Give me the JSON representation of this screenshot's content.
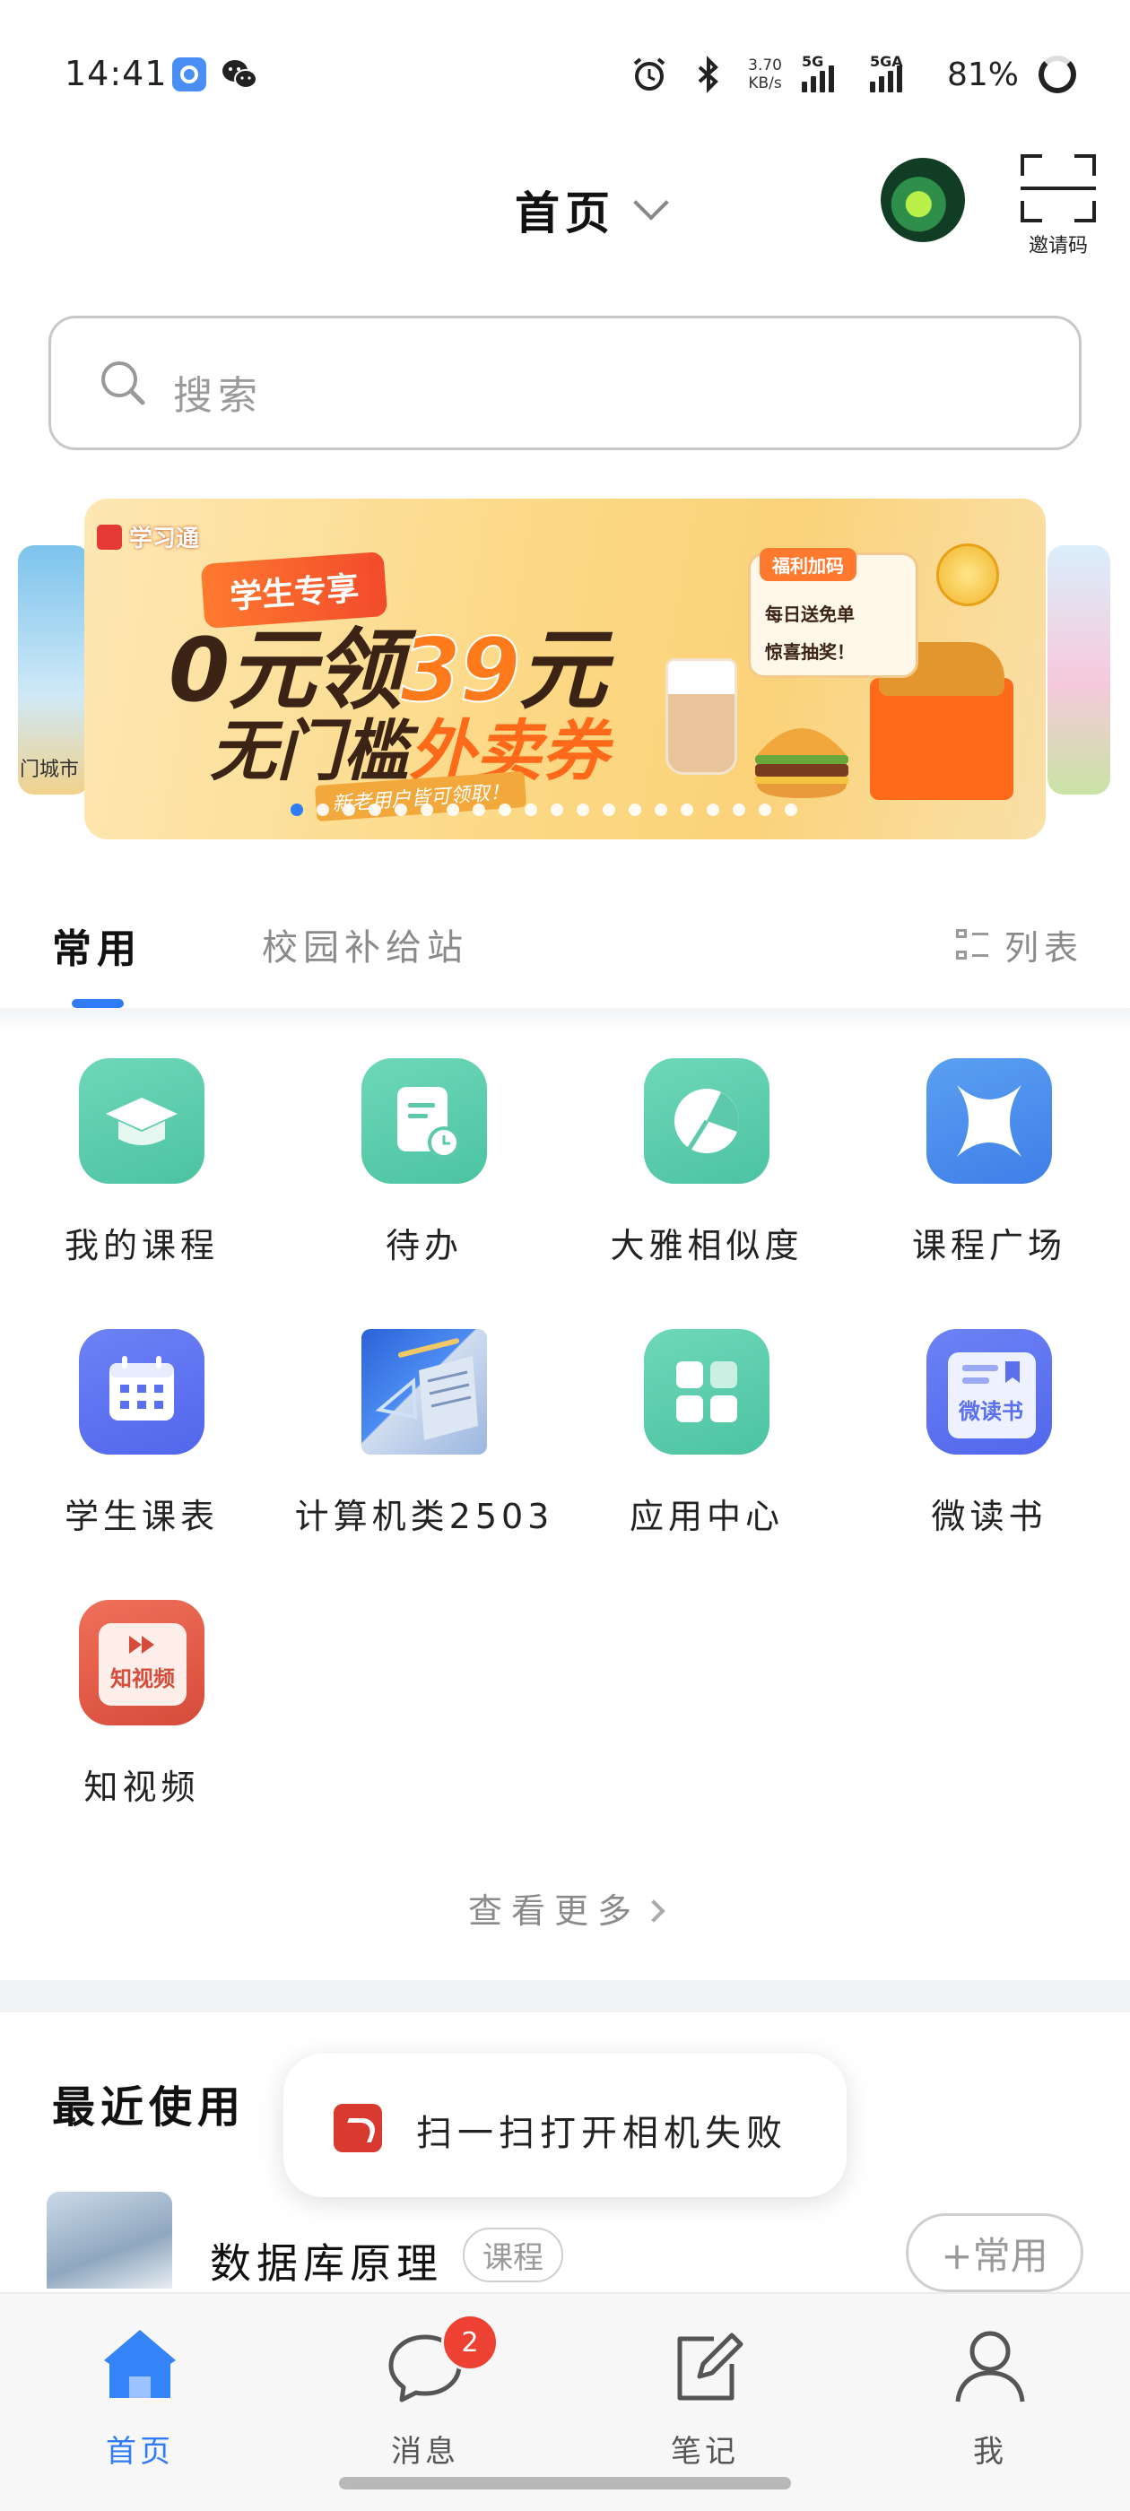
{
  "status_bar": {
    "time": "14:41",
    "net_speed_value": "3.70",
    "net_speed_unit": "KB/s",
    "signal1_tag": "5G",
    "signal2_tag": "5GA",
    "battery_percent": "81%"
  },
  "header": {
    "title": "首页",
    "scan_label": "邀请码"
  },
  "search": {
    "placeholder": "搜索"
  },
  "banner": {
    "brand": "学习通",
    "tag": "学生专享",
    "line1_prefix": "0元领",
    "line1_highlight": "39",
    "line1_suffix": "元",
    "line2_prefix": "无门槛",
    "line2_highlight": "外卖券",
    "note": "新老用户皆可领取！",
    "card_title": "福利加码",
    "card_row1": "每日送免单",
    "card_row2": "惊喜抽奖！",
    "side_left_text": "门城市",
    "slide_count": 20,
    "active_slide": 1
  },
  "tabs": {
    "active": "常用",
    "second": "校园补给站",
    "list_toggle": "列表"
  },
  "apps": [
    {
      "label": "我的课程",
      "icon": "graduation-cap-icon"
    },
    {
      "label": "待办",
      "icon": "todo-clock-icon"
    },
    {
      "label": "大雅相似度",
      "icon": "pie-similarity-icon"
    },
    {
      "label": "课程广场",
      "icon": "course-square-x-icon"
    },
    {
      "label": "学生课表",
      "icon": "calendar-icon"
    },
    {
      "label": "计算机类2503",
      "icon": "class-photo-icon"
    },
    {
      "label": "应用中心",
      "icon": "app-grid-icon"
    },
    {
      "label": "微读书",
      "icon": "book-icon"
    },
    {
      "label": "知视频",
      "icon": "video-icon"
    }
  ],
  "app_icon_text": {
    "weidushu": "微读书",
    "zhishipin": "知视频"
  },
  "see_more": "查看更多",
  "recent": {
    "title": "最近使用",
    "item_name": "数据库原理",
    "item_badge": "课程",
    "add_label": "+常用"
  },
  "toast": {
    "message": "扫一扫打开相机失败"
  },
  "bottom_nav": {
    "items": [
      {
        "label": "首页",
        "icon": "home-icon",
        "active": true
      },
      {
        "label": "消息",
        "icon": "chat-bubble-icon",
        "badge": "2"
      },
      {
        "label": "笔记",
        "icon": "edit-note-icon"
      },
      {
        "label": "我",
        "icon": "person-icon"
      }
    ]
  },
  "colors": {
    "accent": "#2f7cf6",
    "teal": "#52c8a8",
    "badge_red": "#ec4133"
  }
}
